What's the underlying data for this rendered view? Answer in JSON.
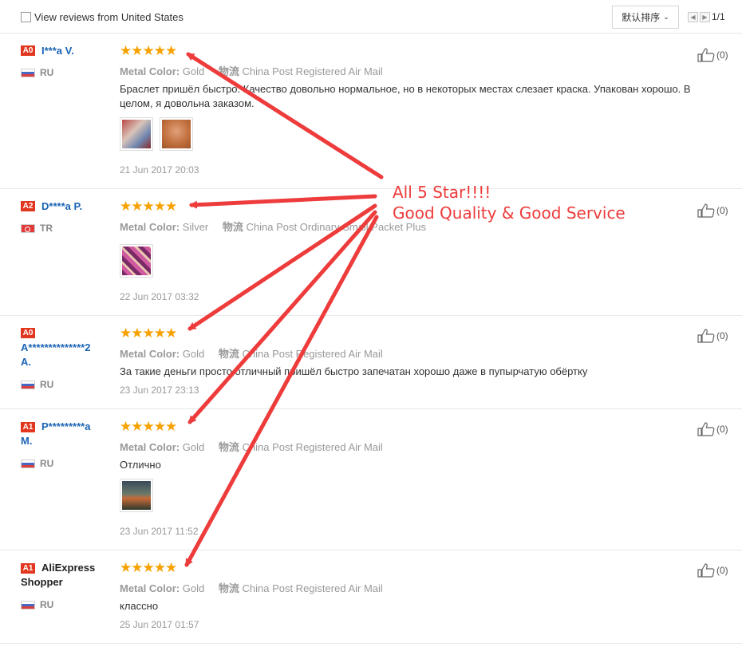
{
  "header": {
    "filter_label": "View reviews from United States",
    "sort_label": "默认排序",
    "pagination": "1/1"
  },
  "reviews": [
    {
      "badge": "A0",
      "user": "I***a V.",
      "country": "RU",
      "stars": "★★★★★",
      "color_label": "Metal Color:",
      "color_value": "Gold",
      "shipping_label": "物流",
      "shipping_value": "China Post Registered Air Mail",
      "text": "Браслет пришёл быстро. Качество довольно нормальное, но в некоторых местах слезает краска. Упакован хорошо. В целом, я довольна заказом.",
      "date": "21 Jun 2017 20:03",
      "likes": "(0)"
    },
    {
      "badge": "A2",
      "user": "D****a P.",
      "country": "TR",
      "stars": "★★★★★",
      "color_label": "Metal Color:",
      "color_value": "Silver",
      "shipping_label": "物流",
      "shipping_value": "China Post Ordinary Small Packet Plus",
      "text": "",
      "date": "22 Jun 2017 03:32",
      "likes": "(0)"
    },
    {
      "badge": "A0",
      "user": "A**************2",
      "user2": "A.",
      "country": "RU",
      "stars": "★★★★★",
      "color_label": "Metal Color:",
      "color_value": "Gold",
      "shipping_label": "物流",
      "shipping_value": "China Post Registered Air Mail",
      "text": "За такие деньги просто отличный пришёл быстро запечатан хорошо даже в пупырчатую обёртку",
      "date": "23 Jun 2017 23:13",
      "likes": "(0)"
    },
    {
      "badge": "A1",
      "user": "P*********a",
      "user2": "M.",
      "country": "RU",
      "stars": "★★★★★",
      "color_label": "Metal Color:",
      "color_value": "Gold",
      "shipping_label": "物流",
      "shipping_value": "China Post Registered Air Mail",
      "text": "Отлично",
      "date": "23 Jun 2017 11:52",
      "likes": "(0)"
    },
    {
      "badge": "A1",
      "user": "AliExpress",
      "user2": "Shopper",
      "country": "RU",
      "stars": "★★★★★",
      "color_label": "Metal Color:",
      "color_value": "Gold",
      "shipping_label": "物流",
      "shipping_value": "China Post Registered Air Mail",
      "text": "классно",
      "date": "25 Jun 2017 01:57",
      "likes": "(0)"
    }
  ],
  "annotation": {
    "line1": "All 5 Star!!!!",
    "line2": "Good Quality & Good Service",
    "color": "#ee3b3b"
  },
  "colors": {
    "badge": "#e2371f",
    "username": "#1c64b4",
    "stars": "#f6a100"
  }
}
